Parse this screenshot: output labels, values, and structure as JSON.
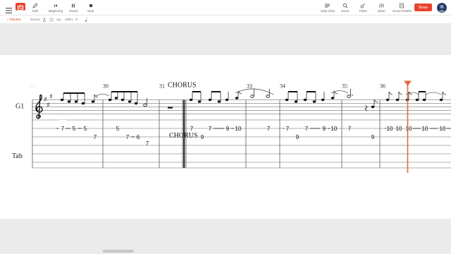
{
  "toolbar": {
    "edit_label": "Edit",
    "beginning_label": "Beginning",
    "pause_label": "Pause",
    "stop_label": "Stop",
    "snip_view_label": "Snip View",
    "zoom_label": "Zoom",
    "parts_label": "Parts",
    "mixer_label": "Mixer",
    "score_details_label": "Score Details",
    "share_label": "Share"
  },
  "subbar": {
    "palettes_label": "« Palettes",
    "sound_label": "Sound",
    "zoom_value": "100%"
  },
  "score": {
    "measure_numbers": [
      "29",
      "30",
      "31",
      "33",
      "34",
      "35",
      "36"
    ],
    "section_label": "CHORUS",
    "section_label_tab": "CHORUS",
    "guitar_label": "G1",
    "tab_label": "Tab",
    "tab_numbers": {
      "m29": [
        "7",
        "5",
        "5",
        "7"
      ],
      "m30": [
        "5",
        "7",
        "6",
        "7"
      ],
      "m32": [
        "7",
        "9",
        "7",
        "9",
        "10"
      ],
      "m33": [
        "7"
      ],
      "m34": [
        "7",
        "9",
        "7",
        "9",
        "10"
      ],
      "m35": [
        "7",
        "9"
      ],
      "m36": [
        "10",
        "10",
        "10",
        "10",
        "10",
        "10"
      ]
    }
  },
  "colors": {
    "accent": "#e8442f",
    "playhead": "#e8663c"
  }
}
